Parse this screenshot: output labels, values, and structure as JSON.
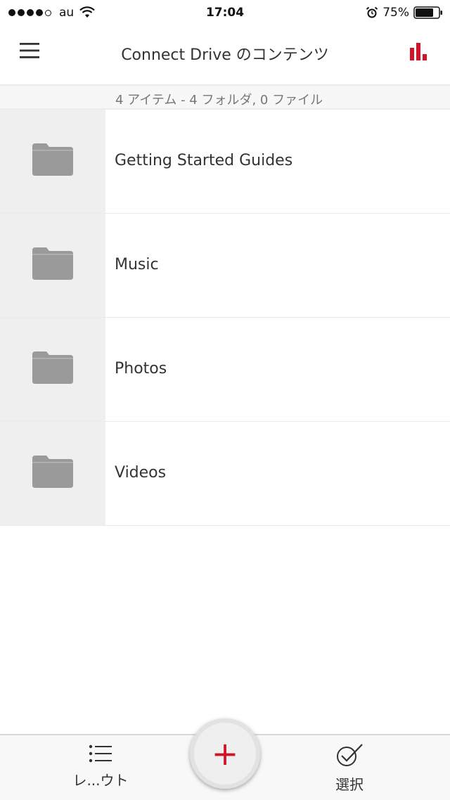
{
  "status_bar": {
    "carrier": "au",
    "time": "17:04",
    "battery": "75%"
  },
  "nav": {
    "title": "Connect Drive のコンテンツ"
  },
  "summary": {
    "text": "4 アイテム - 4 フォルダ, 0 ファイル"
  },
  "folders": [
    {
      "name": "Getting Started Guides",
      "icon": "folder-icon"
    },
    {
      "name": "Music",
      "icon": "folder-icon"
    },
    {
      "name": "Photos",
      "icon": "folder-icon"
    },
    {
      "name": "Videos",
      "icon": "folder-icon"
    }
  ],
  "toolbar": {
    "layout_label": "レ...ウト",
    "add_label": "+",
    "select_label": "選択"
  },
  "colors": {
    "accent": "#d0142c",
    "folder_icon": "#9a9a9a",
    "thumb_bg": "#efefef"
  }
}
